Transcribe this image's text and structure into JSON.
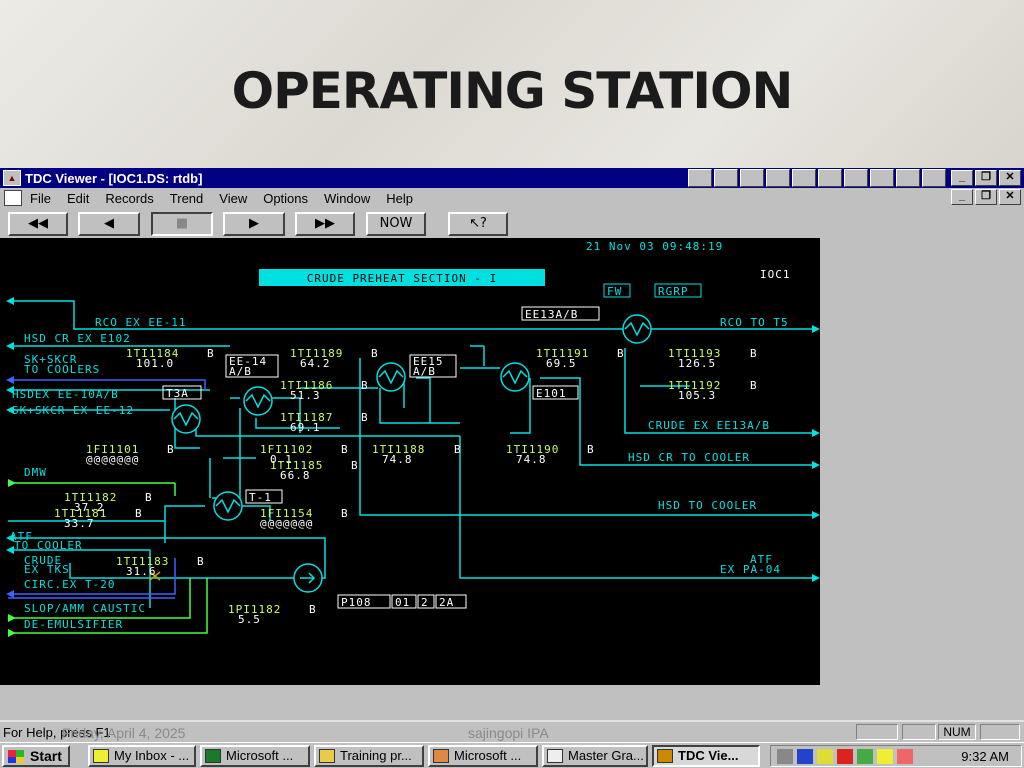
{
  "slide": {
    "title": "OPERATING STATION",
    "footer_date": "Friday, April 4, 2025",
    "footer_author": "sajingopi IPA"
  },
  "window": {
    "title": "TDC Viewer - [IOC1.DS: rtdb]",
    "menu": [
      "File",
      "Edit",
      "Records",
      "Trend",
      "View",
      "Options",
      "Window",
      "Help"
    ],
    "toolbar": {
      "rewind_fast": "◀◀",
      "rewind": "◀",
      "stop": "■",
      "play": "▶",
      "fast_forward": "▶▶",
      "now": "NOW",
      "help": "↖?"
    },
    "status_help": "For Help, press F1",
    "status_num": "NUM"
  },
  "colors": {
    "process_line": "#00e0e0",
    "value_text": "#c8ff60",
    "feed_line": "#40ff40",
    "out_line": "#4060ff",
    "title_box": "#00e0e0"
  },
  "schematic": {
    "timestamp": "21 Nov 03 09:48:19",
    "title": "CRUDE PREHEAT SECTION - I",
    "unit": "IOC1",
    "buttons": [
      "FW",
      "RGRP",
      "EE13A/B",
      "T3A",
      "E101",
      "T-1"
    ],
    "pump_buttons": [
      "P108",
      "01",
      "2",
      "2A"
    ],
    "exchanger_labels": [
      "EE-14\nA/B",
      "EE15\nA/B"
    ],
    "stream_labels": [
      "RCO EX EE-11",
      "HSD CR EX E102",
      "SK+SKCR",
      "TO COOLERS",
      "HSDEX EE-10A/B",
      "SK+SKCR EX EE-12",
      "DMW",
      "ATF",
      "TO COOLER",
      "CRUDE",
      "EX TKS",
      "CIRC.EX T-20",
      "SLOP/AMM CAUSTIC",
      "DE-EMULSIFIER",
      "RCO TO T5",
      "CRUDE EX EE13A/B",
      "HSD CR TO COOLER",
      "HSD TO COOLER",
      "ATF",
      "EX PA-04"
    ],
    "tags": [
      {
        "tag": "1TI1184",
        "value": "101.0",
        "mode": "B"
      },
      {
        "tag": "1TI1189",
        "value": "64.2",
        "mode": "B"
      },
      {
        "tag": "1TI1191",
        "value": "69.5",
        "mode": "B"
      },
      {
        "tag": "1TI1193",
        "value": "126.5",
        "mode": "B"
      },
      {
        "tag": "1TI1186",
        "value": "51.3",
        "mode": "B"
      },
      {
        "tag": "1TI1192",
        "value": "105.3",
        "mode": "B"
      },
      {
        "tag": "1TI1187",
        "value": "69.1",
        "mode": "B"
      },
      {
        "tag": "1FI1101",
        "value": "@@@@@@@",
        "mode": "B"
      },
      {
        "tag": "1FI1102",
        "value": "0.1",
        "mode": "B"
      },
      {
        "tag": "1TI1188",
        "value": "74.8",
        "mode": "B"
      },
      {
        "tag": "1TI1190",
        "value": "74.8",
        "mode": "B"
      },
      {
        "tag": "1TI1185",
        "value": "66.8",
        "mode": "B"
      },
      {
        "tag": "1TI1182",
        "value": "37.2",
        "mode": "B"
      },
      {
        "tag": "1TI1181",
        "value": "33.7",
        "mode": "B"
      },
      {
        "tag": "1FI1154",
        "value": "@@@@@@@",
        "mode": "B"
      },
      {
        "tag": "1TI1183",
        "value": "31.6",
        "mode": "B"
      },
      {
        "tag": "1PI1182",
        "value": "5.5",
        "mode": "B"
      }
    ]
  },
  "taskbar": {
    "start": "Start",
    "tasks": [
      "My Inbox - ...",
      "Microsoft ...",
      "Training pr...",
      "Microsoft ...",
      "Master Gra...",
      "TDC Vie..."
    ],
    "clock": "9:32 AM"
  }
}
